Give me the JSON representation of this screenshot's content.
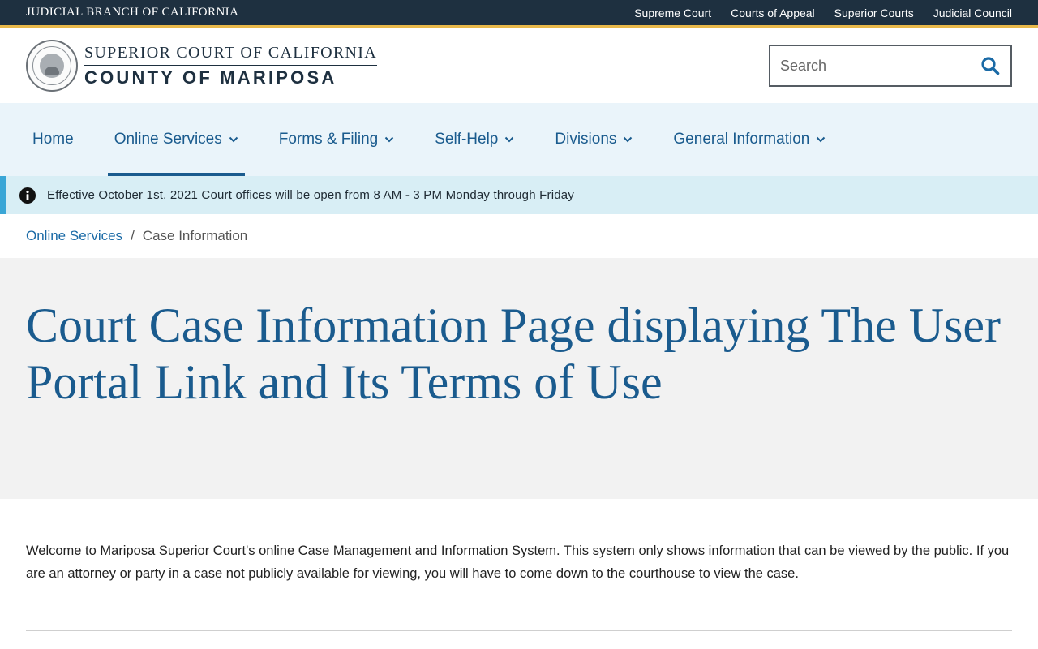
{
  "utility": {
    "branch": "JUDICIAL BRANCH OF CALIFORNIA",
    "links": [
      "Supreme Court",
      "Courts of Appeal",
      "Superior Courts",
      "Judicial Council"
    ]
  },
  "header": {
    "logo_line1": "SUPERIOR COURT OF CALIFORNIA",
    "logo_line2": "COUNTY OF MARIPOSA",
    "search_placeholder": "Search"
  },
  "nav": {
    "items": [
      {
        "label": "Home",
        "has_dropdown": false
      },
      {
        "label": "Online Services",
        "has_dropdown": true,
        "active": true
      },
      {
        "label": "Forms & Filing",
        "has_dropdown": true
      },
      {
        "label": "Self-Help",
        "has_dropdown": true
      },
      {
        "label": "Divisions",
        "has_dropdown": true
      },
      {
        "label": "General Information",
        "has_dropdown": true
      }
    ]
  },
  "alert": {
    "text": "Effective October 1st, 2021 Court offices will be open from 8 AM - 3 PM Monday through Friday"
  },
  "breadcrumb": {
    "parent": "Online Services",
    "separator": "/",
    "current": "Case Information"
  },
  "hero": {
    "title": "Court Case Information Page displaying The User Portal Link and Its Terms of Use"
  },
  "content": {
    "intro": "Welcome to Mariposa Superior Court's online Case Management and Information System. This system only shows information that can be viewed by the public. If you are an attorney or party in a case not publicly available for viewing, you will have to come down to the courthouse to view the case."
  },
  "colors": {
    "utility_bg": "#1e3040",
    "accent_gold": "#e8b84a",
    "brand_blue": "#1a5b8e",
    "nav_bg": "#eaf4fa",
    "alert_bg": "#d8eef5",
    "alert_border": "#3aa6d6",
    "hero_bg": "#f2f2f2"
  }
}
